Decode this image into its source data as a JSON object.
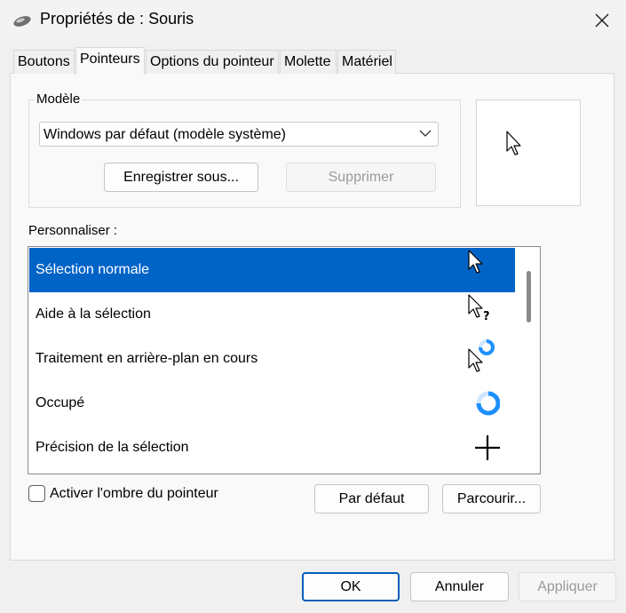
{
  "window": {
    "title": "Propriétés de : Souris"
  },
  "tabs": [
    {
      "label": "Boutons"
    },
    {
      "label": "Pointeurs"
    },
    {
      "label": "Options du pointeur"
    },
    {
      "label": "Molette"
    },
    {
      "label": "Matériel"
    }
  ],
  "active_tab": "Pointeurs",
  "scheme": {
    "group_label": "Modèle",
    "selected_value": "Windows par défaut (modèle système)",
    "save_as_label": "Enregistrer sous...",
    "delete_label": "Supprimer"
  },
  "customize": {
    "label": "Personnaliser :",
    "items": [
      {
        "label": "Sélection normale",
        "icon": "arrow-pointer-icon",
        "selected": true
      },
      {
        "label": "Aide à la sélection",
        "icon": "help-pointer-icon",
        "selected": false
      },
      {
        "label": "Traitement en arrière-plan en cours",
        "icon": "working-in-background-icon",
        "selected": false
      },
      {
        "label": "Occupé",
        "icon": "busy-ring-icon",
        "selected": false
      },
      {
        "label": "Précision de la sélection",
        "icon": "crosshair-icon",
        "selected": false
      }
    ]
  },
  "options": {
    "shadow_label": "Activer l'ombre du pointeur",
    "shadow_checked": false,
    "default_label": "Par défaut",
    "browse_label": "Parcourir..."
  },
  "footer": {
    "ok_label": "OK",
    "cancel_label": "Annuler",
    "apply_label": "Appliquer"
  },
  "colors": {
    "selection": "#0063c6",
    "accent_border": "#005fb8",
    "busy_ring": "#1e90ff"
  }
}
